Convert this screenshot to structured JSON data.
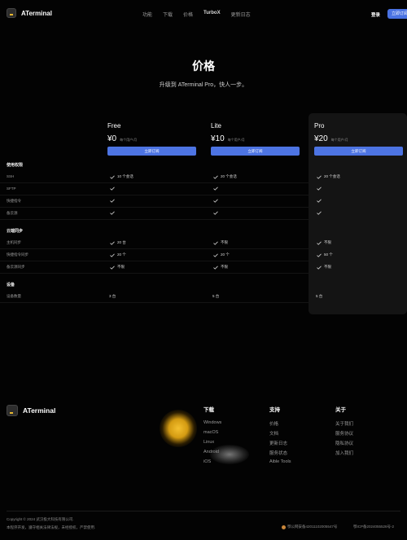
{
  "header": {
    "logo_text": "ATerminal",
    "nav": [
      {
        "label": "功能",
        "name": "nav-features"
      },
      {
        "label": "下载",
        "name": "nav-download"
      },
      {
        "label": "价格",
        "name": "nav-pricing"
      },
      {
        "label": "TurboX",
        "name": "nav-turbox"
      },
      {
        "label": "更新日志",
        "name": "nav-changelog"
      }
    ],
    "login": "登录",
    "subscribe": "立即订阅"
  },
  "hero": {
    "title": "价格",
    "subtitle": "升级到 ATerminal Pro，快人一步。"
  },
  "plans": [
    {
      "name": "Free",
      "price": "¥0",
      "unit": "每个用户/月",
      "button": "立即订阅"
    },
    {
      "name": "Lite",
      "price": "¥10",
      "unit": "每个用户/月",
      "button": "立即订阅"
    },
    {
      "name": "Pro",
      "price": "¥20",
      "unit": "每个用户/月",
      "button": "立即订阅"
    }
  ],
  "sections": [
    {
      "title": "使用权限",
      "rows": [
        {
          "label": "SSH",
          "cells": [
            {
              "check": true,
              "text": "10 个会话"
            },
            {
              "check": true,
              "text": "20 个会话"
            },
            {
              "check": true,
              "text": "20 个会话"
            }
          ]
        },
        {
          "label": "SFTP",
          "cells": [
            {
              "check": true,
              "text": ""
            },
            {
              "check": true,
              "text": ""
            },
            {
              "check": true,
              "text": ""
            }
          ]
        },
        {
          "label": "快捷指令",
          "cells": [
            {
              "check": true,
              "text": ""
            },
            {
              "check": true,
              "text": ""
            },
            {
              "check": true,
              "text": ""
            }
          ]
        },
        {
          "label": "备云源",
          "cells": [
            {
              "check": true,
              "text": ""
            },
            {
              "check": true,
              "text": ""
            },
            {
              "check": true,
              "text": ""
            }
          ]
        }
      ]
    },
    {
      "title": "云端同步",
      "rows": [
        {
          "label": "主机同步",
          "cells": [
            {
              "check": true,
              "text": "20 台"
            },
            {
              "check": true,
              "text": "不限"
            },
            {
              "check": true,
              "text": "不限"
            }
          ]
        },
        {
          "label": "快捷指令同步",
          "cells": [
            {
              "check": true,
              "text": "20 个"
            },
            {
              "check": true,
              "text": "20 个"
            },
            {
              "check": true,
              "text": "50 个"
            }
          ]
        },
        {
          "label": "备云源同步",
          "cells": [
            {
              "check": true,
              "text": "不限"
            },
            {
              "check": true,
              "text": "不限"
            },
            {
              "check": true,
              "text": "不限"
            }
          ]
        }
      ]
    },
    {
      "title": "设备",
      "rows": [
        {
          "label": "设备数量",
          "cells": [
            {
              "check": false,
              "text": "3 台"
            },
            {
              "check": false,
              "text": "5 台"
            },
            {
              "check": false,
              "text": "5 台"
            }
          ]
        }
      ]
    }
  ],
  "footer": {
    "logo_text": "ATerminal",
    "columns": [
      {
        "title": "下载",
        "items": [
          "Windows",
          "macOS",
          "Linux",
          "Android",
          "iOS"
        ]
      },
      {
        "title": "支持",
        "items": [
          "价格",
          "文档",
          "更新日志",
          "服务状态",
          "Aible Tools"
        ]
      },
      {
        "title": "关于",
        "items": [
          "关于我们",
          "服务协议",
          "隐私协议",
          "加入我们"
        ]
      }
    ],
    "copyright": "Copyright © 2024 武汉极大科技有限公司.",
    "disclaimer": "本程序开发，遵守相关法律法规，未经授权，严禁使用.",
    "police": "鄂公网安备42011102005547号",
    "icp": "鄂ICP备2024055526号-2"
  },
  "colors": {
    "accent": "#4d74e3",
    "background": "#030303",
    "pro_panel": "#141414",
    "glow": "#f4c030"
  }
}
